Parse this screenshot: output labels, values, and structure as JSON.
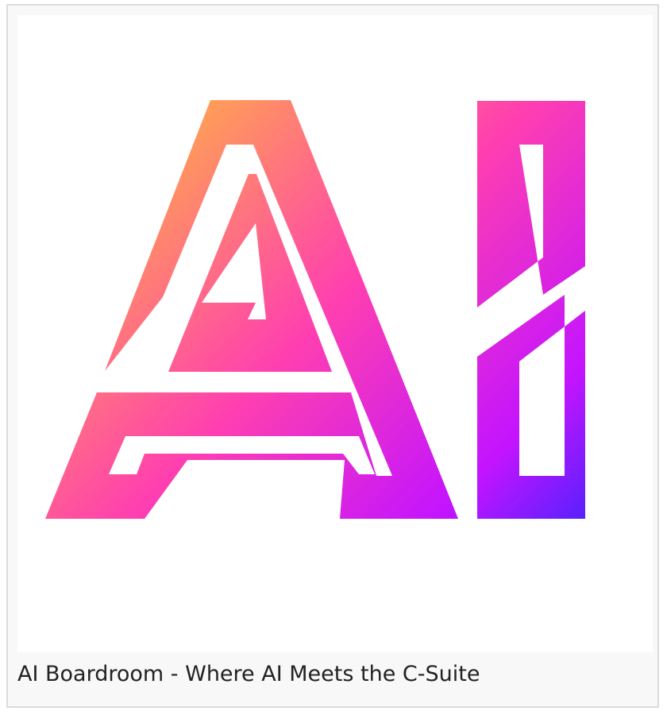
{
  "card": {
    "image": {
      "icon": "ai-logo",
      "alt_text": "AI",
      "gradient": [
        "#ffa94d",
        "#ff3fb0",
        "#c314ff",
        "#3c24ff"
      ]
    },
    "caption": "AI Boardroom - Where AI Meets the C-Suite"
  }
}
